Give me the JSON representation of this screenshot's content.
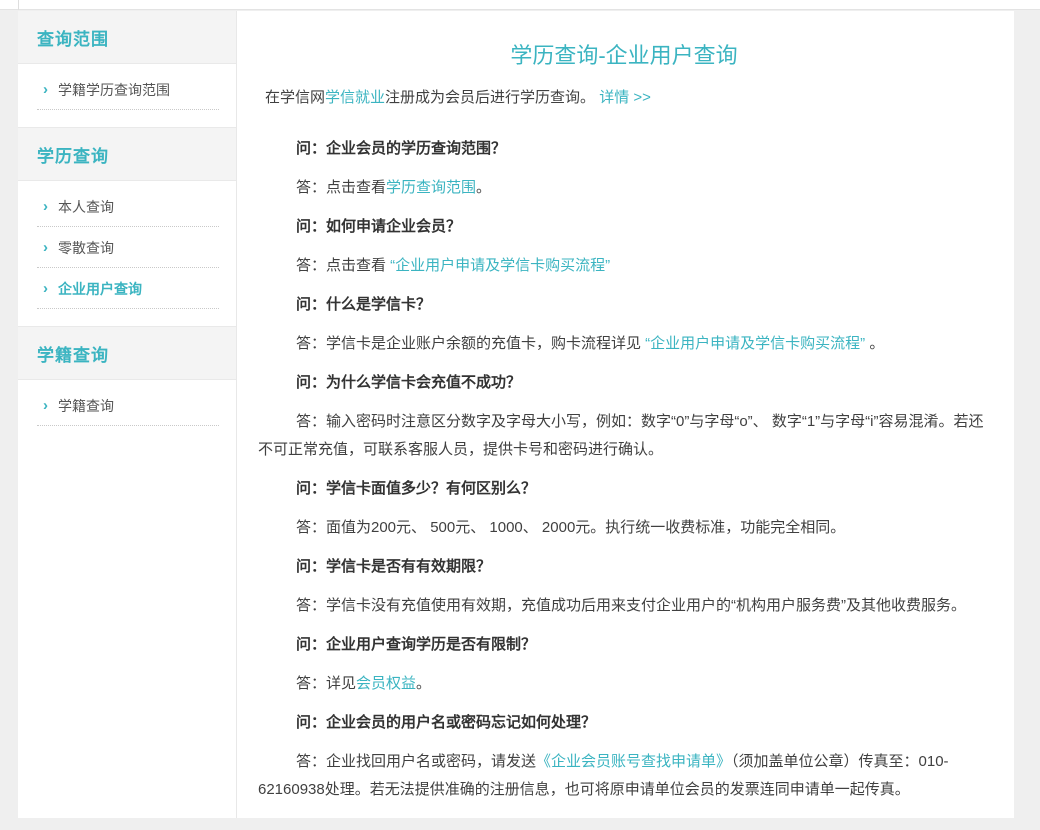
{
  "theme": {
    "accent": "#3bb4c1",
    "page_bg": "#efefef",
    "panel_bg": "#ffffff",
    "section_header_bg": "#f4f4f4",
    "question_color": "#333333",
    "body_color": "#404040",
    "sidebar_item_color": "#555555"
  },
  "sidebar": {
    "chevron_icon": "›",
    "sections": [
      {
        "title": "查询范围",
        "items": [
          {
            "label": "学籍学历查询范围",
            "active": false
          }
        ]
      },
      {
        "title": "学历查询",
        "items": [
          {
            "label": "本人查询",
            "active": false
          },
          {
            "label": "零散查询",
            "active": false
          },
          {
            "label": "企业用户查询",
            "active": true
          }
        ]
      },
      {
        "title": "学籍查询",
        "items": [
          {
            "label": "学籍查询",
            "active": false
          }
        ]
      }
    ]
  },
  "main": {
    "title": "学历查询-企业用户查询",
    "intro_parts": [
      {
        "type": "text",
        "text": "在学信网"
      },
      {
        "type": "link",
        "text": "学信就业"
      },
      {
        "type": "text",
        "text": "注册成为会员后进行学历查询。 "
      },
      {
        "type": "link",
        "text": "详情 >>"
      }
    ],
    "qa": [
      {
        "question": "问：企业会员的学历查询范围？",
        "answer_parts": [
          {
            "type": "text",
            "text": "答：点击查看"
          },
          {
            "type": "link",
            "text": "学历查询范围"
          },
          {
            "type": "text",
            "text": "。"
          }
        ]
      },
      {
        "question": "问：如何申请企业会员？",
        "answer_parts": [
          {
            "type": "text",
            "text": "答：点击查看 "
          },
          {
            "type": "link",
            "text": "“企业用户申请及学信卡购买流程”"
          }
        ]
      },
      {
        "question": "问：什么是学信卡？",
        "answer_parts": [
          {
            "type": "text",
            "text": "答：学信卡是企业账户余额的充值卡，购卡流程详见 "
          },
          {
            "type": "link",
            "text": "“企业用户申请及学信卡购买流程”"
          },
          {
            "type": "text",
            "text": " 。"
          }
        ]
      },
      {
        "question": "问：为什么学信卡会充值不成功？",
        "answer_parts": [
          {
            "type": "text",
            "text": "答：输入密码时注意区分数字及字母大小写，例如：数字“0”与字母“o”、 数字“1”与字母“i”容易混淆。若还不可正常充值，可联系客服人员，提供卡号和密码进行确认。"
          }
        ]
      },
      {
        "question": "问：学信卡面值多少？有何区别么？",
        "answer_parts": [
          {
            "type": "text",
            "text": "答：面值为200元、 500元、 1000、 2000元。执行统一收费标准，功能完全相同。"
          }
        ]
      },
      {
        "question": "问：学信卡是否有有效期限？",
        "answer_parts": [
          {
            "type": "text",
            "text": "答：学信卡没有充值使用有效期，充值成功后用来支付企业用户的“机构用户服务费”及其他收费服务。"
          }
        ]
      },
      {
        "question": "问：企业用户查询学历是否有限制？",
        "answer_parts": [
          {
            "type": "text",
            "text": "答：详见"
          },
          {
            "type": "link",
            "text": "会员权益"
          },
          {
            "type": "text",
            "text": "。"
          }
        ]
      },
      {
        "question": "问：企业会员的用户名或密码忘记如何处理？",
        "answer_parts": [
          {
            "type": "text",
            "text": "答：企业找回用户名或密码，请发送"
          },
          {
            "type": "link",
            "text": "《企业会员账号查找申请单》"
          },
          {
            "type": "text",
            "text": "（须加盖单位公章）传真至：010-62160938处理。若无法提供准确的注册信息，也可将原申请单位会员的发票连同申请单一起传真。"
          }
        ]
      }
    ]
  }
}
